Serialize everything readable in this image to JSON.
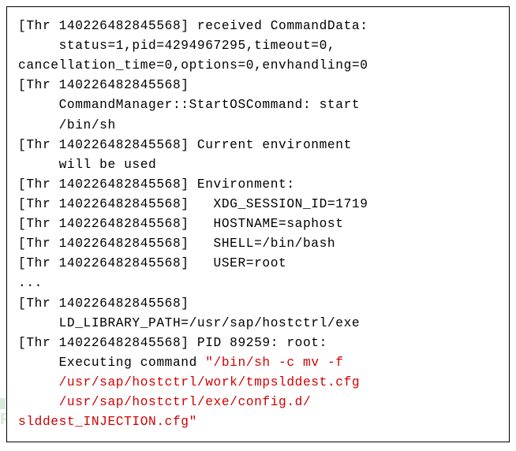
{
  "log": {
    "thread_id": "140226482845568",
    "lines": {
      "l1a": "[Thr 140226482845568] received CommandData:",
      "l1b": "     status=1,pid=4294967295,timeout=0,",
      "l1c": "cancellation_time=0,options=0,envhandling=0",
      "l2a": "[Thr 140226482845568]",
      "l2b": "     CommandManager::StartOSCommand: start",
      "l2c": "     /bin/sh",
      "l3a": "[Thr 140226482845568] Current environment",
      "l3b": "     will be used",
      "l4": "[Thr 140226482845568] Environment:",
      "l5": "[Thr 140226482845568]   XDG_SESSION_ID=1719",
      "l6": "[Thr 140226482845568]   HOSTNAME=saphost",
      "l7": "[Thr 140226482845568]   SHELL=/bin/bash",
      "l8": "[Thr 140226482845568]   USER=root",
      "l9": "...",
      "l10a": "[Thr 140226482845568]",
      "l10b": "     LD_LIBRARY_PATH=/usr/sap/hostctrl/exe",
      "l11a": "[Thr 140226482845568] PID 89259: root:",
      "l11b": "     Executing command ",
      "cmd1": "\"/bin/sh -c mv -f",
      "cmd2": "     /usr/sap/hostctrl/work/tmpslddest.cfg",
      "cmd3": "     /usr/sap/hostctrl/exe/config.d/",
      "cmd4": "slddest_INJECTION.cfg\""
    },
    "env": {
      "XDG_SESSION_ID": "1719",
      "HOSTNAME": "saphost",
      "SHELL": "/bin/bash",
      "USER": "root",
      "LD_LIBRARY_PATH": "/usr/sap/hostctrl/exe"
    },
    "command": {
      "pid": "89259",
      "user": "root",
      "text": "\"/bin/sh -c mv -f /usr/sap/hostctrl/work/tmpslddest.cfg /usr/sap/hostctrl/exe/config.d/slddest_INJECTION.cfg\""
    }
  },
  "watermark": "FREEBUF"
}
